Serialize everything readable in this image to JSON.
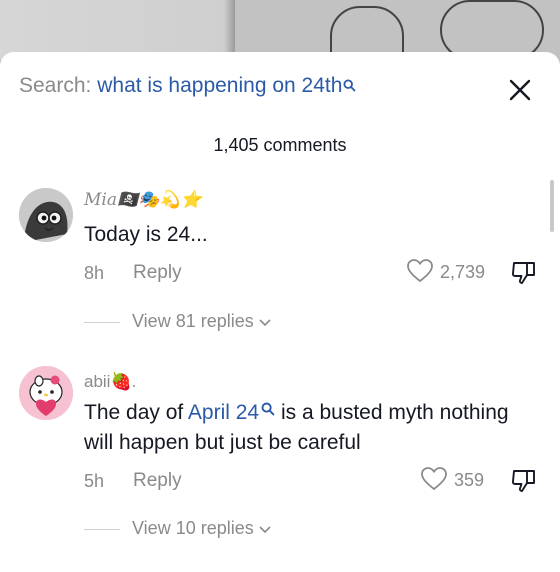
{
  "search": {
    "label": "Search:",
    "query": "what is happening on 24th"
  },
  "comments_count": "1,405 comments",
  "comments": [
    {
      "username": "Mia",
      "username_emojis": "🏴‍☠️🎭💫⭐",
      "text": "Today is 24...",
      "time": "8h",
      "reply_label": "Reply",
      "likes": "2,739",
      "view_replies": "View 81 replies"
    },
    {
      "username": "abii",
      "username_emojis": "🍓.",
      "text_prefix": "The day of ",
      "text_highlight": "April 24",
      "text_suffix": " is a busted myth nothing will happen but just be careful",
      "time": "5h",
      "reply_label": "Reply",
      "likes": "359",
      "view_replies": "View 10 replies"
    }
  ],
  "colors": {
    "link_blue": "#2b5aa8",
    "muted_gray": "#8a8a8a",
    "text_dark": "#161823"
  }
}
